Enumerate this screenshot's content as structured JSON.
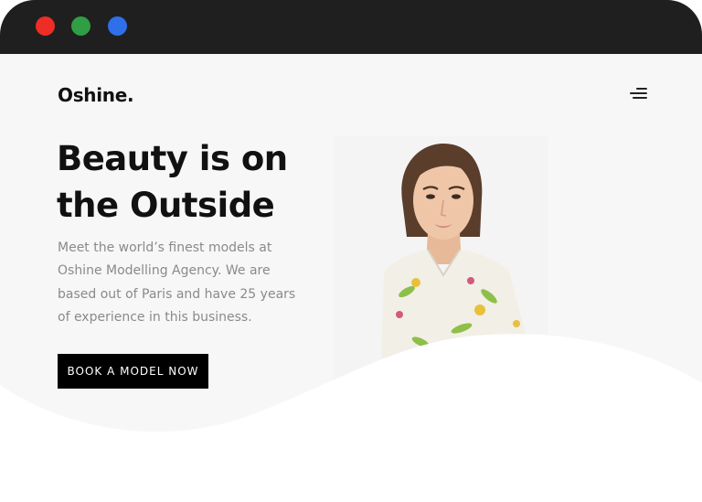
{
  "window": {
    "controls": [
      "close",
      "minimize",
      "maximize"
    ],
    "colors": {
      "close": "#ee2d27",
      "minimize": "#2f9e44",
      "maximize": "#2f6fea",
      "titlebar": "#1f1f1f"
    }
  },
  "nav": {
    "logo": "Oshine.",
    "menu_icon": "hamburger-menu-icon"
  },
  "hero": {
    "headline_line1": "Beauty is on",
    "headline_line2": "the Outside",
    "description": "Meet the world’s finest models at Oshine Modelling Agency. We are based out of Paris and have 25 years of experience in this business.",
    "cta_label": "BOOK A MODEL NOW",
    "colors": {
      "background": "#f8f8f8",
      "text": "#111111",
      "muted": "#8a8a8a",
      "button": "#000000"
    }
  }
}
